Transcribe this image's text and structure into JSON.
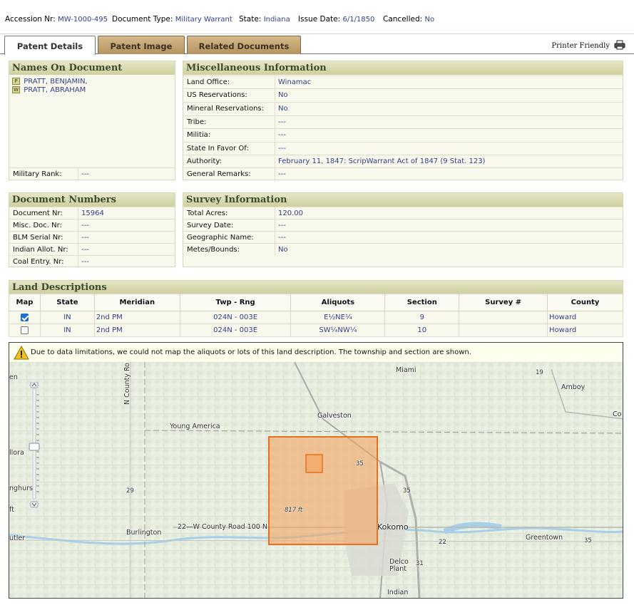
{
  "header": {
    "accession_label": "Accession Nr:",
    "accession_value": "MW-1000-495",
    "doctype_label": "Document Type:",
    "doctype_value": "Military Warrant",
    "state_label": "State:",
    "state_value": "Indiana",
    "issue_label": "Issue Date:",
    "issue_value": "6/1/1850",
    "cancelled_label": "Cancelled:",
    "cancelled_value": "No"
  },
  "tabs": [
    {
      "label": "Patent Details"
    },
    {
      "label": "Patent Image"
    },
    {
      "label": "Related Documents"
    }
  ],
  "printer_friendly": "Printer Friendly",
  "names_panel": {
    "title": "Names On Document",
    "names": [
      {
        "badge": "P",
        "name": "PRATT, BENJAMIN,"
      },
      {
        "badge": "W",
        "name": "PRATT, ABRAHAM"
      }
    ],
    "military_rank_label": "Military Rank:",
    "military_rank_value": "---"
  },
  "misc_panel": {
    "title": "Miscellaneous Information",
    "rows": [
      {
        "label": "Land Office:",
        "value": "Winamac"
      },
      {
        "label": "US Reservations:",
        "value": "No"
      },
      {
        "label": "Mineral Reservations:",
        "value": "No"
      },
      {
        "label": "Tribe:",
        "value": "---"
      },
      {
        "label": "Militia:",
        "value": "---"
      },
      {
        "label": "State In Favor Of:",
        "value": "---"
      },
      {
        "label": "Authority:",
        "value": "February 11, 1847: ScripWarrant Act of 1847 (9 Stat. 123)"
      },
      {
        "label": "General Remarks:",
        "value": "---"
      }
    ]
  },
  "docnum_panel": {
    "title": "Document Numbers",
    "rows": [
      {
        "label": "Document Nr:",
        "value": "15964"
      },
      {
        "label": "Misc. Doc. Nr:",
        "value": "---"
      },
      {
        "label": "BLM Serial Nr:",
        "value": "---"
      },
      {
        "label": "Indian Allot. Nr:",
        "value": "---"
      },
      {
        "label": "Coal Entry. Nr:",
        "value": "---"
      }
    ]
  },
  "survey_panel": {
    "title": "Survey Information",
    "rows": [
      {
        "label": "Total Acres:",
        "value": "120.00"
      },
      {
        "label": "Survey Date:",
        "value": "---"
      },
      {
        "label": "Geographic Name:",
        "value": "---"
      },
      {
        "label": "Metes/Bounds:",
        "value": "No"
      }
    ]
  },
  "land": {
    "title": "Land Descriptions",
    "columns": [
      "Map",
      "State",
      "Meridian",
      "Twp - Rng",
      "Aliquots",
      "Section",
      "Survey #",
      "County"
    ],
    "rows": [
      {
        "checked": true,
        "state": "IN",
        "meridian": "2nd PM",
        "twp_rng": "024N - 003E",
        "aliquots": "E½NE¼",
        "section": "9",
        "survey": "",
        "county": "Howard"
      },
      {
        "checked": false,
        "state": "IN",
        "meridian": "2nd PM",
        "twp_rng": "024N - 003E",
        "aliquots": "SW¼NW¼",
        "section": "10",
        "survey": "",
        "county": "Howard"
      }
    ],
    "warning": "Due to data limitations, we could not map the aliquots or lots of this land description. The township and section are shown."
  },
  "map": {
    "labels": [
      "Miami",
      "Amboy",
      "Galveston",
      "Young America",
      "Kokomo",
      "Burlington",
      "Greentown",
      "Delco Plant",
      "Indian",
      "N County Ro",
      "22—W County Road 100 N",
      "817 ft",
      "en",
      "llora",
      "nghurs",
      "utler",
      "Co",
      "19",
      "35",
      "29",
      "22",
      "35",
      "31",
      "35",
      "ft"
    ],
    "highlight_color": "#f4a460",
    "highlight_border": "#e8701a"
  }
}
